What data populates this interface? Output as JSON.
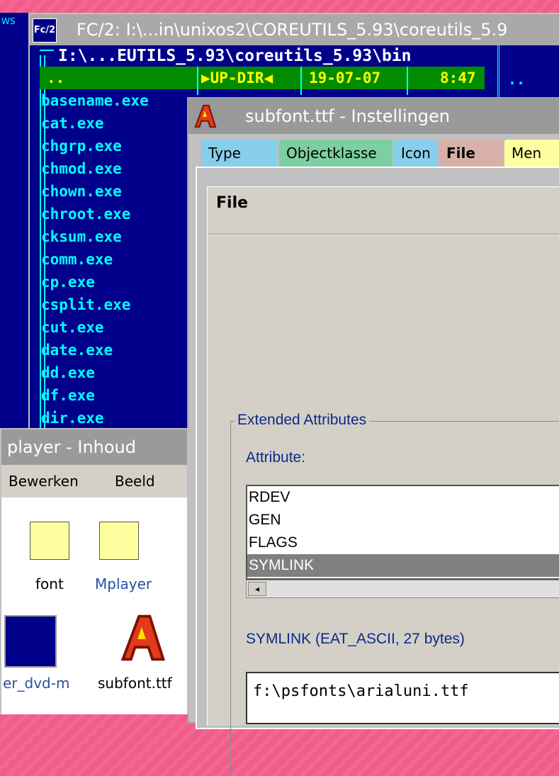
{
  "desktop": {
    "ws_label": "WS"
  },
  "fc_window": {
    "icon": "Fc/2",
    "title": "FC/2: I:\\...in\\unixos2\\COREUTILS_5.93\\coreutils_5.9",
    "path": "I:\\...EUTILS_5.93\\coreutils_5.93\\bin",
    "updir": {
      "name": "..",
      "type": "▶UP-DIR◀",
      "date": "19-07-07",
      "time": "8:47"
    },
    "files": [
      "basename.exe",
      "cat.exe",
      "chgrp.exe",
      "chmod.exe",
      "chown.exe",
      "chroot.exe",
      "cksum.exe",
      "comm.exe",
      "cp.exe",
      "csplit.exe",
      "cut.exe",
      "date.exe",
      "dd.exe",
      "df.exe",
      "dir.exe"
    ],
    "right_dots": ".."
  },
  "settings_window": {
    "title": "subfont.ttf - Instellingen",
    "tabs": [
      "Type",
      "Objectklasse",
      "Icon",
      "File",
      "Men"
    ],
    "section_heading": "File",
    "ea_group": "Extended Attributes",
    "attribute_label": "Attribute:",
    "attributes": [
      "RDEV",
      "GEN",
      "FLAGS",
      "SYMLINK"
    ],
    "selected_attribute": "SYMLINK",
    "symlink_label": "SYMLINK (EAT_ASCII, 27 bytes)",
    "symlink_value": "f:\\psfonts\\arialuni.ttf"
  },
  "mplayer_window": {
    "title": "player - Inhoud",
    "menu": [
      "Bewerken",
      "Beeld"
    ],
    "icons": [
      "font",
      "Mplayer",
      "er_dvd-m",
      "subfont.ttf"
    ]
  }
}
